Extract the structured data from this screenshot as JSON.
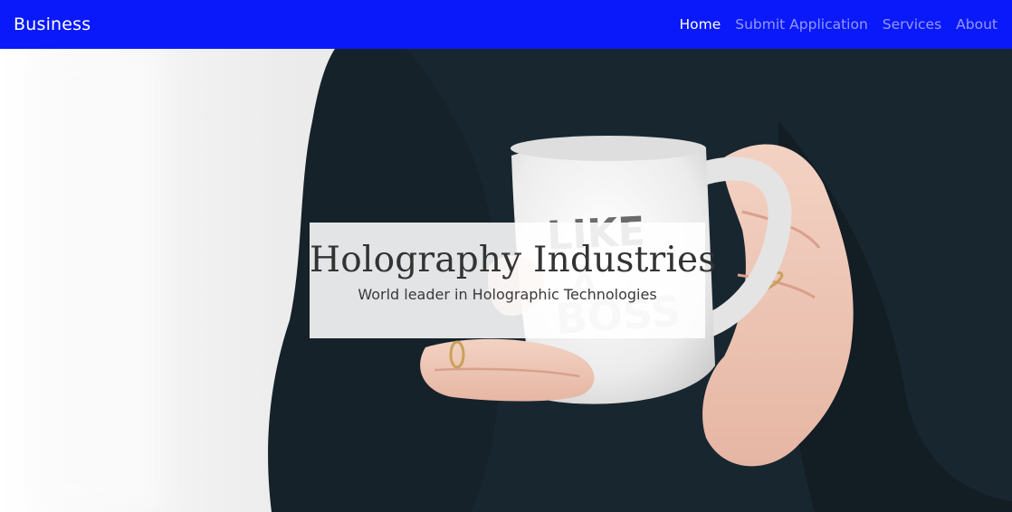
{
  "navbar": {
    "brand": "Business",
    "links": [
      {
        "label": "Home",
        "active": true
      },
      {
        "label": "Submit Application",
        "active": false
      },
      {
        "label": "Services",
        "active": false
      },
      {
        "label": "About",
        "active": false
      }
    ],
    "background": "#0a19fa"
  },
  "hero": {
    "title": "Holography Industries",
    "subtitle": "World leader in Holographic Technologies",
    "mug_text": "LIKE A BOSS"
  }
}
